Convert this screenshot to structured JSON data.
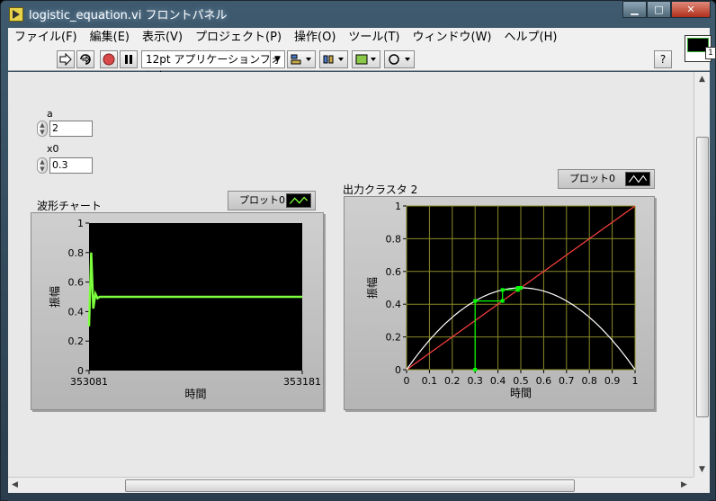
{
  "window": {
    "title": "logistic_equation.vi フロントパネル",
    "controls": {
      "minimize": "▁",
      "maximize": "□",
      "close": "✕"
    }
  },
  "menu": [
    "ファイル(F)",
    "編集(E)",
    "表示(V)",
    "プロジェクト(P)",
    "操作(O)",
    "ツール(T)",
    "ウィンドウ(W)",
    "ヘルプ(H)"
  ],
  "toolbar": {
    "run_icon": "run-arrow-icon",
    "run_continuous_icon": "run-continuously-icon",
    "abort_icon": "abort-icon",
    "pause_icon": "pause-icon",
    "font_selector": "12pt アプリケーションフォント",
    "help_label": "?"
  },
  "vi_icon": {
    "connector": "1"
  },
  "controls": {
    "a": {
      "label": "a",
      "value": "2"
    },
    "x0": {
      "label": "x0",
      "value": "0.3"
    }
  },
  "chart_data": [
    {
      "type": "line",
      "title": "波形チャート",
      "legend": "プロット0",
      "xlabel": "時間",
      "ylabel": "振幅",
      "xlim": [
        353081,
        353181
      ],
      "ylim": [
        0,
        1
      ],
      "x_ticks": [
        "353081",
        "353181"
      ],
      "y_ticks": [
        "0",
        "0.2",
        "0.4",
        "0.6",
        "0.8",
        "1"
      ],
      "grid": false,
      "series": [
        {
          "color": "#7cff3c",
          "x": [
            353081,
            353082,
            353083,
            353084,
            353085,
            353086,
            353181
          ],
          "values": [
            0.3,
            0.8,
            0.42,
            0.52,
            0.49,
            0.5,
            0.5
          ]
        }
      ]
    },
    {
      "type": "line",
      "title": "出力クラスタ 2",
      "legend": "プロット0",
      "xlabel": "時間",
      "ylabel": "振幅",
      "xlim": [
        0,
        1
      ],
      "ylim": [
        0,
        1
      ],
      "x_ticks": [
        "0",
        "0.1",
        "0.2",
        "0.3",
        "0.4",
        "0.5",
        "0.6",
        "0.7",
        "0.8",
        "0.9",
        "1"
      ],
      "y_ticks": [
        "0",
        "0.2",
        "0.4",
        "0.6",
        "0.8",
        "1"
      ],
      "grid": true,
      "series": [
        {
          "color": "#ff4040",
          "x": [
            0,
            1
          ],
          "values": [
            0,
            1
          ]
        },
        {
          "color": "#ffffff",
          "function": "2*x*(1-x)"
        },
        {
          "color": "#00ff00",
          "x": [
            0.3,
            0.3,
            0.42,
            0.42,
            0.4872,
            0.4872,
            0.4997,
            0.4997,
            0.5
          ],
          "values": [
            0,
            0.42,
            0.42,
            0.4872,
            0.4872,
            0.4997,
            0.4997,
            0.5,
            0.5
          ]
        }
      ]
    }
  ]
}
